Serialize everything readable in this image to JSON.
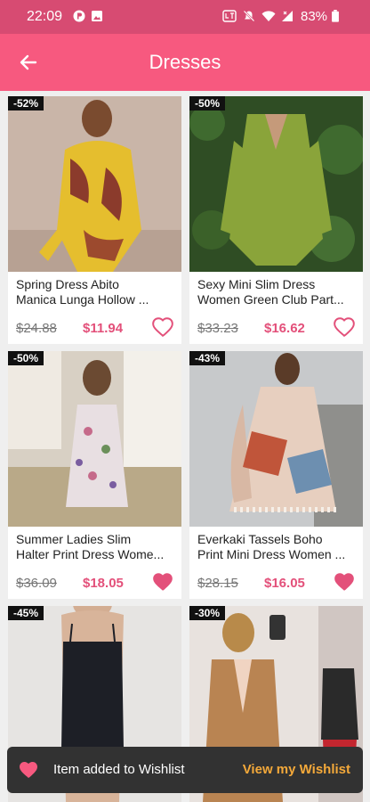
{
  "status_bar": {
    "time": "22:09",
    "battery": "83%"
  },
  "app_bar": {
    "title": "Dresses"
  },
  "colors": {
    "accent": "#f7597f",
    "price": "#e3507a",
    "status_bar": "#d74b72",
    "snackbar_action": "#f4a93a"
  },
  "products": [
    {
      "discount": "-52%",
      "name_line1": "Spring Dress Abito",
      "name_line2": "Manica Lunga Hollow ...",
      "old_price": "$24.88",
      "new_price": "$11.94",
      "wishlisted": false
    },
    {
      "discount": "-50%",
      "name_line1": "Sexy Mini Slim Dress",
      "name_line2": "Women Green Club Part...",
      "old_price": "$33.23",
      "new_price": "$16.62",
      "wishlisted": false
    },
    {
      "discount": "-50%",
      "name_line1": "Summer Ladies Slim",
      "name_line2": "Halter Print Dress Wome...",
      "old_price": "$36.09",
      "new_price": "$18.05",
      "wishlisted": true
    },
    {
      "discount": "-43%",
      "name_line1": "Everkaki Tassels Boho",
      "name_line2": "Print Mini Dress Women ...",
      "old_price": "$28.15",
      "new_price": "$16.05",
      "wishlisted": true
    },
    {
      "discount": "-45%"
    },
    {
      "discount": "-30%"
    }
  ],
  "snackbar": {
    "message": "Item added to Wishlist",
    "action": "View my Wishlist"
  }
}
